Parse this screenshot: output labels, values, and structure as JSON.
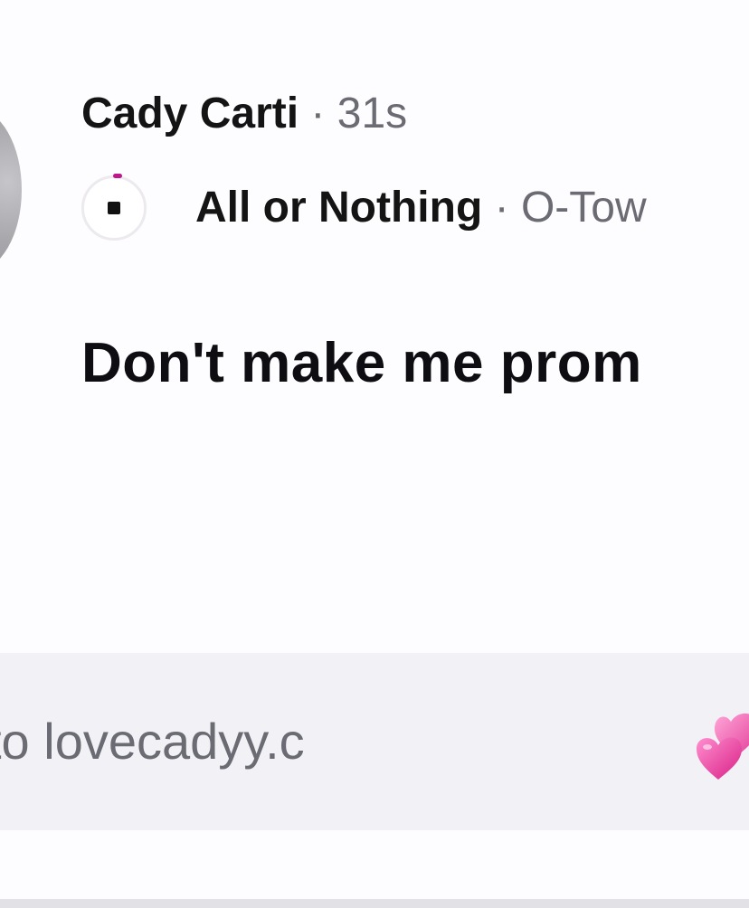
{
  "post": {
    "username": "Cady Carti",
    "time_separator": "·",
    "time": "31s",
    "text": "Don't make me prom"
  },
  "music": {
    "song_title": "All or Nothing",
    "separator": "·",
    "artist": "O-Tow",
    "icon": "stop-icon",
    "progress_color": "#c0168c"
  },
  "link": {
    "text": "to lovecadyy.c",
    "emoji": "two-hearts-icon"
  },
  "colors": {
    "text_primary": "#141414",
    "text_secondary": "#6b6b73",
    "link_bar_background": "#f2f1f6",
    "heart_pink": "#e83e9e"
  }
}
